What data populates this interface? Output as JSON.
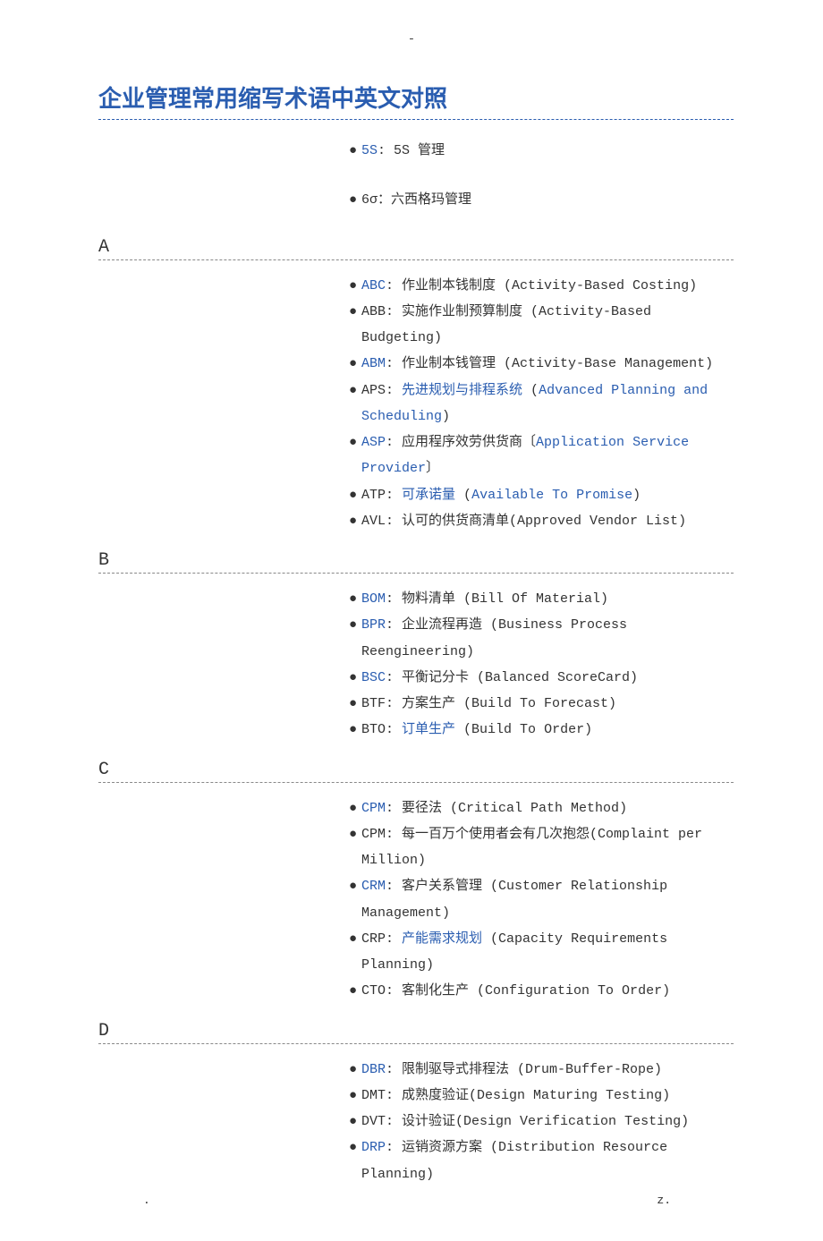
{
  "marks": {
    "top": "-",
    "bl": ".",
    "br": "z."
  },
  "title": "企业管理常用缩写术语中英文对照",
  "intro": [
    {
      "abbr": "5S",
      "abbrLink": true,
      "sep": ": ",
      "parts": [
        {
          "t": " 5S 管理"
        }
      ]
    },
    {
      "abbr": "6σ",
      "abbrLink": false,
      "sep": "：",
      "parts": [
        {
          "t": "六西格玛管理"
        }
      ]
    }
  ],
  "sections": [
    {
      "letter": "A",
      "items": [
        {
          "abbr": "ABC",
          "abbrLink": true,
          "sep": ": ",
          "parts": [
            {
              "t": "作业制本钱制度 (Activity-Based Costing)"
            }
          ]
        },
        {
          "abbr": "ABB",
          "abbrLink": false,
          "sep": ": ",
          "parts": [
            {
              "t": "实施作业制预算制度 (Activity-Based Budgeting)"
            }
          ]
        },
        {
          "abbr": "ABM",
          "abbrLink": true,
          "sep": ": ",
          "parts": [
            {
              "t": "作业制本钱管理 (Activity-Base Management)"
            }
          ]
        },
        {
          "abbr": "APS",
          "abbrLink": false,
          "sep": ": ",
          "parts": [
            {
              "t": "先进规划与排程系统",
              "link": true
            },
            {
              "t": " ("
            },
            {
              "t": "Advanced Planning and Scheduling",
              "link": true
            },
            {
              "t": ")"
            }
          ]
        },
        {
          "abbr": "ASP",
          "abbrLink": true,
          "sep": ": ",
          "parts": [
            {
              "t": "应用程序效劳供货商〔"
            },
            {
              "t": "Application Service Provider",
              "link": true
            },
            {
              "t": "〕"
            }
          ]
        },
        {
          "abbr": "ATP",
          "abbrLink": false,
          "sep": ": ",
          "parts": [
            {
              "t": "可承诺量",
              "link": true
            },
            {
              "t": " ("
            },
            {
              "t": "Available To Promise",
              "link": true
            },
            {
              "t": ")"
            }
          ]
        },
        {
          "abbr": "AVL",
          "abbrLink": false,
          "sep": ": ",
          "parts": [
            {
              "t": "认可的供货商清单(Approved Vendor List)"
            }
          ]
        }
      ]
    },
    {
      "letter": "B",
      "items": [
        {
          "abbr": "BOM",
          "abbrLink": true,
          "sep": ":  ",
          "parts": [
            {
              "t": "物料清单 (Bill Of Material)"
            }
          ]
        },
        {
          "abbr": "BPR",
          "abbrLink": true,
          "sep": ":  ",
          "parts": [
            {
              "t": "企业流程再造 (Business Process Reengineering)"
            }
          ]
        },
        {
          "abbr": "BSC",
          "abbrLink": true,
          "sep": ":  ",
          "parts": [
            {
              "t": "平衡记分卡 (Balanced ScoreCard)"
            }
          ]
        },
        {
          "abbr": "BTF",
          "abbrLink": false,
          "sep": ":  ",
          "parts": [
            {
              "t": "方案生产 (Build To Forecast)"
            }
          ]
        },
        {
          "abbr": "BTO",
          "abbrLink": false,
          "sep": ":  ",
          "parts": [
            {
              "t": "订单生产",
              "link": true
            },
            {
              "t": " (Build To Order)"
            }
          ]
        }
      ]
    },
    {
      "letter": "C",
      "items": [
        {
          "abbr": "CPM",
          "abbrLink": true,
          "sep": ":  ",
          "parts": [
            {
              "t": "要径法 (Critical Path Method)"
            }
          ]
        },
        {
          "abbr": "CPM",
          "abbrLink": false,
          "sep": ":  ",
          "parts": [
            {
              "t": "每一百万个使用者会有几次抱怨(Complaint per Million)"
            }
          ]
        },
        {
          "abbr": "CRM",
          "abbrLink": true,
          "sep": ":  ",
          "parts": [
            {
              "t": "客户关系管理 (Customer Relationship Management)"
            }
          ]
        },
        {
          "abbr": "CRP",
          "abbrLink": false,
          "sep": ":  ",
          "parts": [
            {
              "t": "产能需求规划",
              "link": true
            },
            {
              "t": " (Capacity Requirements Planning)"
            }
          ]
        },
        {
          "abbr": "CTO",
          "abbrLink": false,
          "sep": ":  ",
          "parts": [
            {
              "t": "客制化生产 (Configuration To Order)"
            }
          ]
        }
      ]
    },
    {
      "letter": "D",
      "items": [
        {
          "abbr": "DBR",
          "abbrLink": true,
          "sep": ":  ",
          "parts": [
            {
              "t": "限制驱导式排程法 (Drum-Buffer-Rope)"
            }
          ]
        },
        {
          "abbr": "DMT",
          "abbrLink": false,
          "sep": ":  ",
          "parts": [
            {
              "t": "成熟度验证(Design Maturing Testing)"
            }
          ]
        },
        {
          "abbr": "DVT",
          "abbrLink": false,
          "sep": ":  ",
          "parts": [
            {
              "t": "设计验证(Design Verification Testing)"
            }
          ]
        },
        {
          "abbr": "DRP",
          "abbrLink": true,
          "sep": ":  ",
          "parts": [
            {
              "t": "运销资源方案 (Distribution Resource Planning)"
            }
          ]
        }
      ]
    }
  ]
}
